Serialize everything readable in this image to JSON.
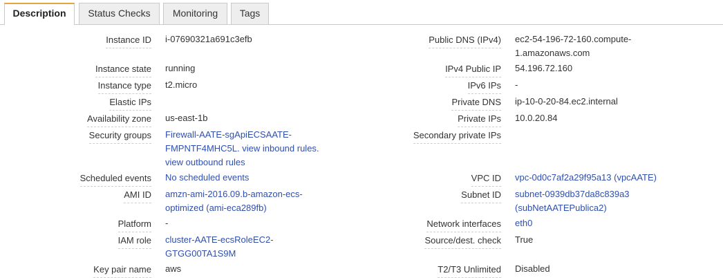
{
  "tabs": [
    {
      "label": "Description",
      "active": true
    },
    {
      "label": "Status Checks",
      "active": false
    },
    {
      "label": "Monitoring",
      "active": false
    },
    {
      "label": "Tags",
      "active": false
    }
  ],
  "left": {
    "instance_id": {
      "label": "Instance ID",
      "value": "i-07690321a691c3efb"
    },
    "instance_state": {
      "label": "Instance state",
      "value": "running"
    },
    "instance_type": {
      "label": "Instance type",
      "value": "t2.micro"
    },
    "elastic_ips": {
      "label": "Elastic IPs",
      "value": ""
    },
    "availability_zone": {
      "label": "Availability zone",
      "value": "us-east-1b"
    },
    "security_groups": {
      "label": "Security groups",
      "line1": "Firewall-AATE-sgApiECSAATE-",
      "line2a": "FMPNTF4MHC5L",
      "line2b": ". ",
      "line2c": "view inbound rules",
      "line2d": ".",
      "line3": "view outbound rules"
    },
    "scheduled_events": {
      "label": "Scheduled events",
      "value": "No scheduled events"
    },
    "ami_id": {
      "label": "AMI ID",
      "line1": "amzn-ami-2016.09.b-amazon-ecs-",
      "line2": "optimized (ami-eca289fb)"
    },
    "platform": {
      "label": "Platform",
      "value": "-"
    },
    "iam_role": {
      "label": "IAM role",
      "line1": "cluster-AATE-ecsRoleEC2-",
      "line2": "GTGG00TA1S9M"
    },
    "key_pair": {
      "label": "Key pair name",
      "value": "aws"
    }
  },
  "right": {
    "public_dns": {
      "label": "Public DNS (IPv4)",
      "line1": "ec2-54-196-72-160.compute-",
      "line2": "1.amazonaws.com"
    },
    "ipv4_public_ip": {
      "label": "IPv4 Public IP",
      "value": "54.196.72.160"
    },
    "ipv6_ips": {
      "label": "IPv6 IPs",
      "value": "-"
    },
    "private_dns": {
      "label": "Private DNS",
      "value": "ip-10-0-20-84.ec2.internal"
    },
    "private_ips": {
      "label": "Private IPs",
      "value": "10.0.20.84"
    },
    "secondary_private_ips": {
      "label": "Secondary private IPs",
      "value": ""
    },
    "vpc_id": {
      "label": "VPC ID",
      "value": "vpc-0d0c7af2a29f95a13 (vpcAATE)"
    },
    "subnet_id": {
      "label": "Subnet ID",
      "line1": "subnet-0939db37da8c839a3",
      "line2": "(subNetAATEPublica2)"
    },
    "network_interfaces": {
      "label": "Network interfaces",
      "value": "eth0"
    },
    "source_dest_check": {
      "label": "Source/dest. check",
      "value": "True"
    },
    "t2_t3_unlimited": {
      "label": "T2/T3 Unlimited",
      "value": "Disabled"
    }
  },
  "colors": {
    "link": "#2f4fae",
    "active_tab_accent": "#e7a33e"
  }
}
